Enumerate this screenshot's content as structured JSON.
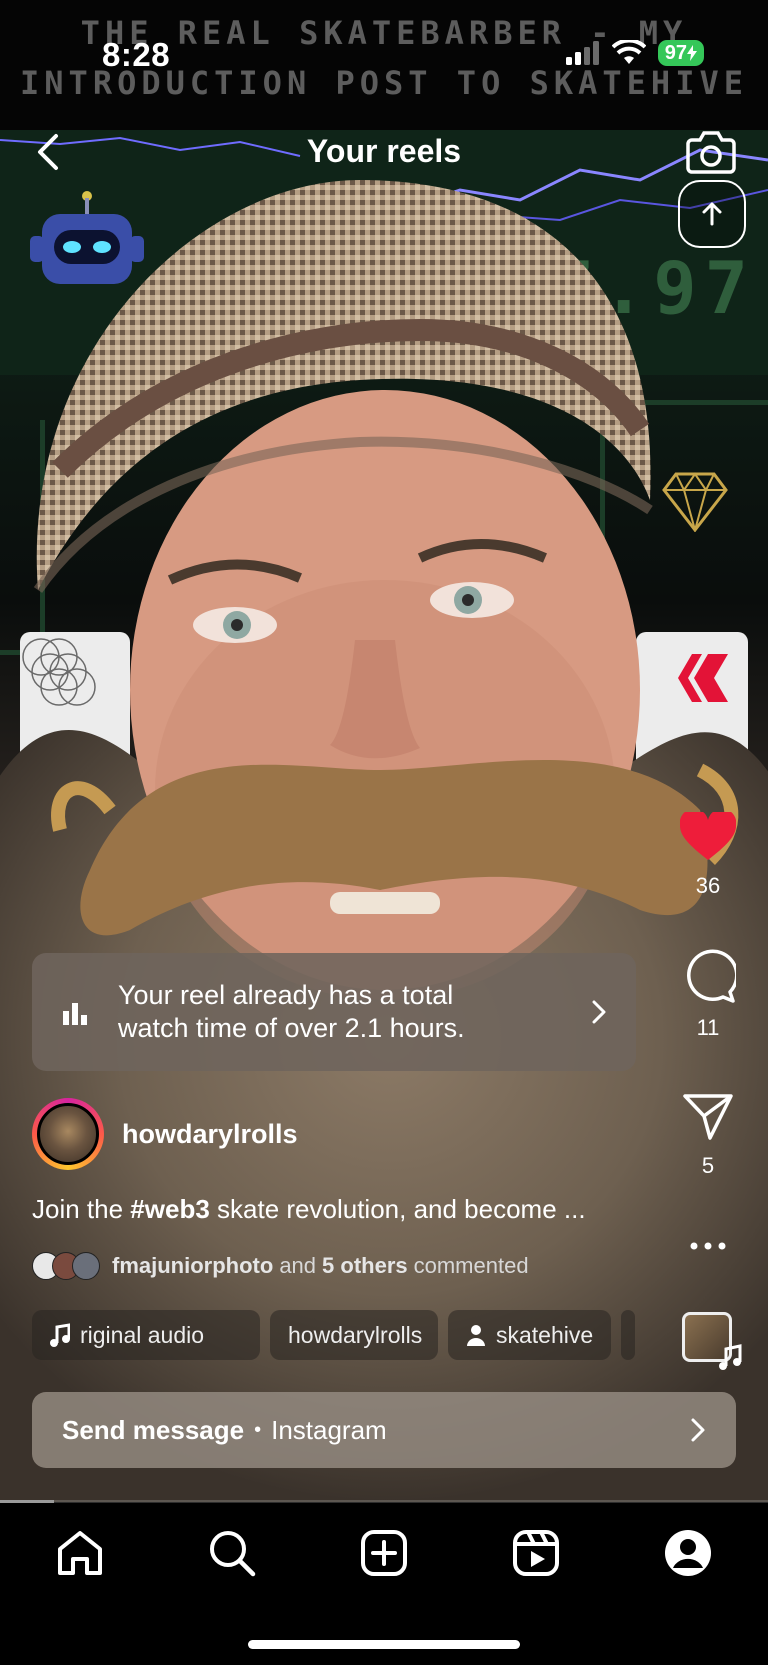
{
  "status_bar": {
    "time": "8:28",
    "battery": "97"
  },
  "video": {
    "banner_line1": "THE REAL SKATEBARBER - MY",
    "banner_line2": "INTRODUCTION POST TO SKATEHIVE",
    "ticker": "17.97"
  },
  "header": {
    "title": "Your reels",
    "back_icon": "chevron-left-icon",
    "camera_icon": "camera-icon",
    "upload_icon": "arrow-up-icon"
  },
  "rail": {
    "likes": "36",
    "comments": "11",
    "shares": "5",
    "like_color": "#ee1d3a"
  },
  "insight": {
    "text_line1": "Your reel already has a total",
    "text_line2": "watch time of over 2.1 hours."
  },
  "owner": {
    "username": "howdarylrolls"
  },
  "caption": {
    "prefix": "Join the ",
    "hashtag": "#web3",
    "rest": " skate revolution, and become ..."
  },
  "commenters": {
    "name": "fmajuniorphoto",
    "and": "and",
    "others": "5 others",
    "suffix": "commented"
  },
  "chips": {
    "audio": "riginal audio",
    "user": "howdarylrolls",
    "tag": "skatehive"
  },
  "send_message": {
    "label": "Send message",
    "separator": "•",
    "sub": "Instagram"
  },
  "progress": {
    "fraction": 0.07
  },
  "tabbar": {
    "items": [
      "home-icon",
      "search-icon",
      "create-icon",
      "reels-icon",
      "profile-icon"
    ]
  }
}
